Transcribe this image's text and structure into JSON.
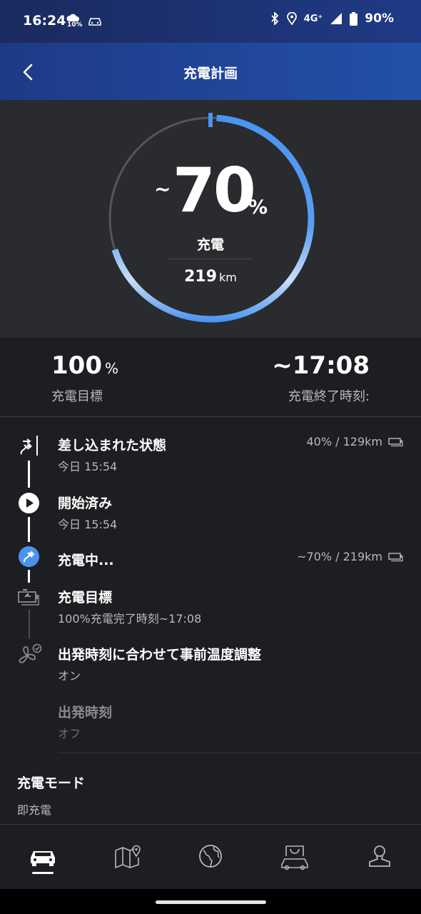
{
  "status_bar": {
    "time": "16:24",
    "weather_pct": "10%",
    "network": "4G⁺",
    "battery": "90%"
  },
  "header": {
    "title": "充電計画"
  },
  "gauge": {
    "tilde": "~",
    "value": "70",
    "percent_sign": "%",
    "fill_fraction": 0.7,
    "label": "充電",
    "range_value": "219",
    "range_unit": "km"
  },
  "summary": {
    "target_value": "100",
    "target_unit": "%",
    "target_label": "充電目標",
    "end_time_value": "~17:08",
    "end_time_label": "充電終了時刻:"
  },
  "timeline": [
    {
      "title": "差し込まれた状態",
      "subtitle": "今日 15:54",
      "right": "40% / 129km",
      "icon": "plug-in-icon"
    },
    {
      "title": "開始済み",
      "subtitle": "今日 15:54",
      "right": "",
      "icon": "play-icon"
    },
    {
      "title": "充電中...",
      "subtitle": "",
      "right": "~70% / 219km",
      "icon": "charging-icon"
    },
    {
      "title": "充電目標",
      "subtitle": "100%充電完了時刻~17:08",
      "right": "",
      "icon": "charge-target-icon"
    },
    {
      "title": "出発時刻に合わせて事前温度調整",
      "subtitle": "オン",
      "right": "",
      "icon": "fan-check-icon"
    },
    {
      "title": "出発時刻",
      "subtitle": "オフ",
      "right": "",
      "icon": ""
    }
  ],
  "charge_mode": {
    "title": "充電モード",
    "value": "即充電"
  },
  "bottom_nav": [
    "car-icon",
    "map-pin-icon",
    "globe-icon",
    "shop-icon",
    "profile-icon"
  ],
  "colors": {
    "accent": "#4a94f0",
    "background": "#1d1e21",
    "panel": "#2a2b2e",
    "header": "#2350a8"
  }
}
